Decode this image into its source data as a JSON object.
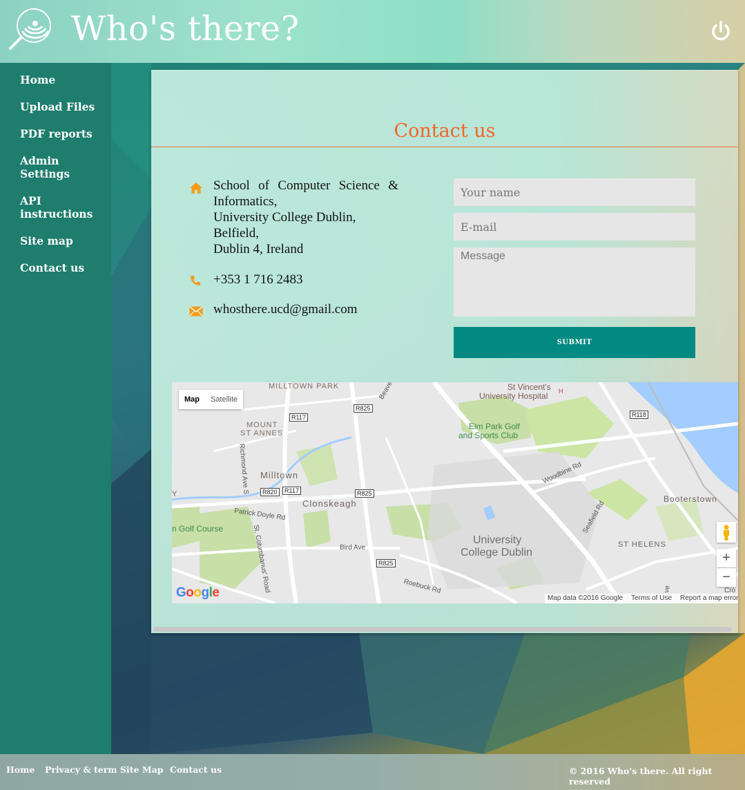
{
  "header": {
    "title": "Who's there?",
    "logo_icon": "radar-search-icon",
    "power_icon": "power-icon"
  },
  "sidebar": {
    "items": [
      {
        "label": "Home"
      },
      {
        "label": "Upload Files"
      },
      {
        "label": "PDF reports"
      },
      {
        "label": "Admin Settings"
      },
      {
        "label": "API instructions"
      },
      {
        "label": "Site map"
      },
      {
        "label": "Contact us"
      }
    ]
  },
  "contact": {
    "title": "Contact us",
    "address_lines": [
      "School of Computer Science &",
      "Informatics,",
      "University College Dublin,",
      "Belfield,",
      "Dublin 4, Ireland"
    ],
    "phone": "+353 1 716 2483",
    "email": "whosthere.ucd@gmail.com",
    "accent_color": "#f2642a",
    "icon_color": "#f59c1a"
  },
  "form": {
    "name_placeholder": "Your name",
    "email_placeholder": "E-mail",
    "message_placeholder": "Message",
    "submit_label": "SUBMIT",
    "submit_color": "#008a82"
  },
  "map": {
    "type_map": "Map",
    "type_satellite": "Satellite",
    "labels": {
      "milltown_park": "MILLTOWN PARK",
      "beaver": "Beaver",
      "st_vincents": "St Vincent's",
      "st_vincents_2": "University Hospital",
      "h": "H",
      "mount": "MOUNT",
      "st_annes": "ST ANNES",
      "elm_park": "Elm Park Golf",
      "elm_park_2": "and Sports Club",
      "milltown": "Milltown",
      "richmond": "Richmond Ave S",
      "woodbine": "Woodbine Rd",
      "booterstown": "Booterstown",
      "clonskeagh": "Clonskeagh",
      "patrick_doyle": "Patrick Doyle Rd",
      "golf_course": "n Golf Course",
      "columbanus": "St. Columbanus' Road",
      "bird_ave": "Bird Ave",
      "ucd_1": "University",
      "ucd_2": "College Dublin",
      "seafield": "Seafield Rd",
      "st_helens": "ST HELENS",
      "roebuck": "Roebuck Rd",
      "y": "Y",
      "cro": "Cro",
      "ve": "ve"
    },
    "shields": {
      "r825a": "R825",
      "r117a": "R117",
      "r118": "R118",
      "r820": "R820",
      "r117b": "R117",
      "r825b": "R825",
      "r825c": "R825"
    },
    "zoom_in": "+",
    "zoom_out": "−",
    "google": "Google",
    "footer": {
      "data": "Map data ©2016 Google",
      "terms": "Terms of Use",
      "report": "Report a map error"
    }
  },
  "footer": {
    "links": [
      {
        "label": "Home"
      },
      {
        "label": "Privacy & term"
      },
      {
        "label": "Site Map"
      },
      {
        "label": "Contact us"
      }
    ],
    "copyright": "© 2016 Who's there. All right reserved"
  }
}
